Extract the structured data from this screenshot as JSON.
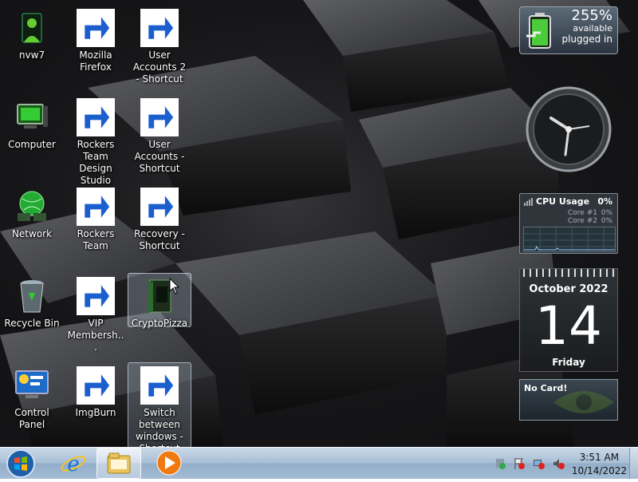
{
  "desktop": {
    "icons": [
      {
        "label": "nvw7",
        "glyph": "nvidia-app-icon"
      },
      {
        "label": "Mozilla Firefox",
        "glyph": "firefox-icon"
      },
      {
        "label": "User Accounts 2 - Shortcut",
        "glyph": "blank-file-icon"
      },
      {
        "label": "Computer",
        "glyph": "computer-icon"
      },
      {
        "label": "Rockers Team Design Studio",
        "glyph": "internet-explorer-icon"
      },
      {
        "label": "User Accounts - Shortcut",
        "glyph": "users-icon"
      },
      {
        "label": "Network",
        "glyph": "network-globe-icon"
      },
      {
        "label": "Rockers Team",
        "glyph": "internet-explorer-icon"
      },
      {
        "label": "Recovery - Shortcut",
        "glyph": "recovery-icon"
      },
      {
        "label": "Recycle Bin",
        "glyph": "recycle-bin-icon"
      },
      {
        "label": "VIP Membersh...",
        "glyph": "internet-explorer-icon"
      },
      {
        "label": "CryptoPizza",
        "glyph": "book-icon"
      },
      {
        "label": "Control Panel",
        "glyph": "control-panel-icon"
      },
      {
        "label": "ImgBurn",
        "glyph": "disc-icon"
      },
      {
        "label": "Switch between windows - Shortcut",
        "glyph": "switch-windows-icon"
      }
    ]
  },
  "gadgets": {
    "battery": {
      "percent": "255%",
      "line1": "available",
      "line2": "plugged in"
    },
    "cpu": {
      "title": "CPU Usage",
      "total": "0%",
      "core1_label": "Core #1",
      "core1_value": "0%",
      "core2_label": "Core #2",
      "core2_value": "0%"
    },
    "calendar": {
      "month_year": "October 2022",
      "day": "14",
      "weekday": "Friday"
    },
    "nvidia": {
      "message": "No Card!"
    }
  },
  "taskbar": {
    "time": "3:51 AM",
    "date": "10/14/2022",
    "pinned": [
      "internet-explorer-icon",
      "windows-explorer-icon",
      "media-player-icon"
    ]
  },
  "colors": {
    "taskbar": "#a9bfd6",
    "selection": "#c8dcf0"
  }
}
